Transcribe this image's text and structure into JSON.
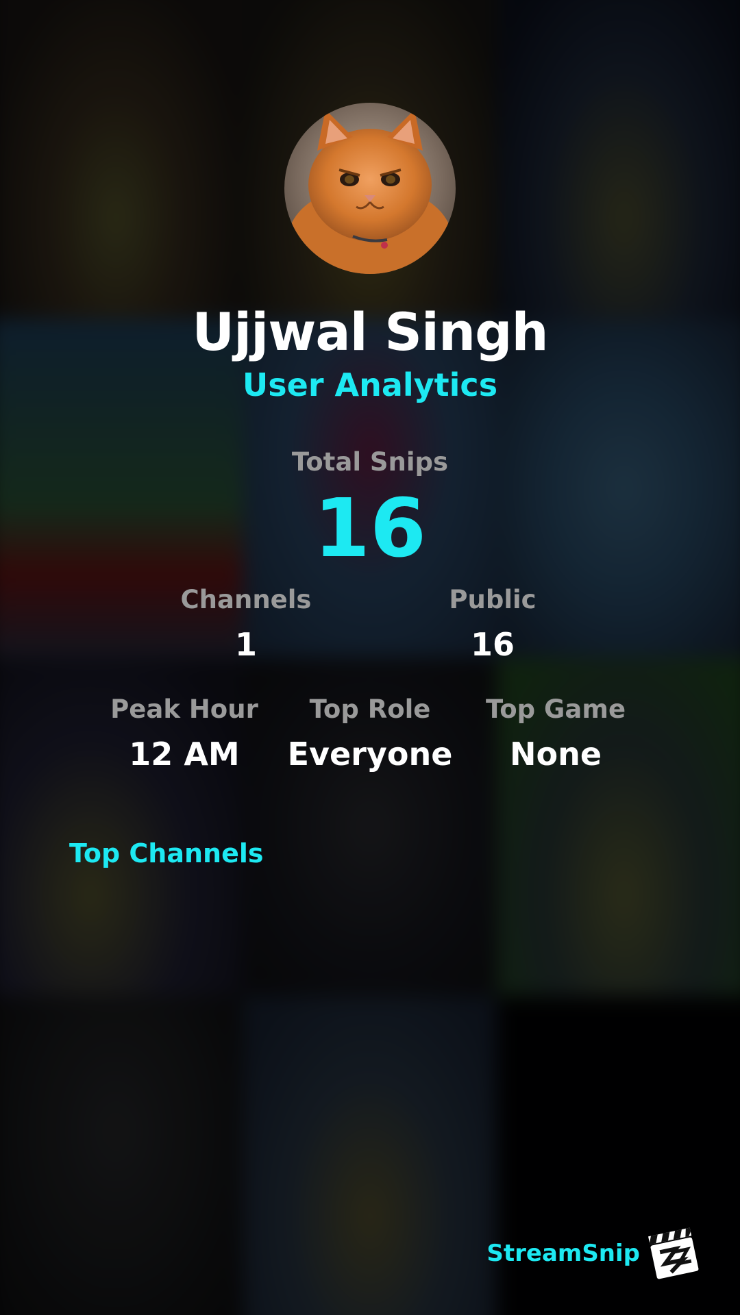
{
  "profile": {
    "name": "Ujjwal Singh",
    "subtitle": "User Analytics",
    "avatar_icon": "cat-photo-avatar"
  },
  "total": {
    "label": "Total Snips",
    "value": "16"
  },
  "row1": [
    {
      "label": "Channels",
      "value": "1"
    },
    {
      "label": "Public",
      "value": "16"
    }
  ],
  "row2": [
    {
      "label": "Peak Hour",
      "value": "12 AM"
    },
    {
      "label": "Top Role",
      "value": "Everyone"
    },
    {
      "label": "Top Game",
      "value": "None"
    }
  ],
  "top_channels": {
    "heading": "Top Channels"
  },
  "brand": {
    "name": "StreamSnip",
    "logo_icon": "clapperboard-logo-icon"
  },
  "colors": {
    "accent": "#1de9f2",
    "label_gray": "#9a9a9a",
    "text_white": "#ffffff"
  }
}
